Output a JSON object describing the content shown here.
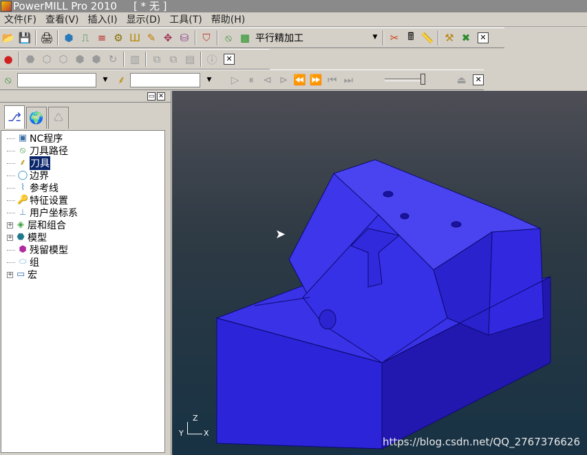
{
  "window": {
    "title": "PowerMILL Pro 2010",
    "document": "[ * 无 ]"
  },
  "menu": [
    "文件(F)",
    "查看(V)",
    "插入(I)",
    "显示(D)",
    "工具(T)",
    "帮助(H)"
  ],
  "toolbar": {
    "strategy_value": "平行精加工",
    "tool_combo_value": "",
    "tool_combo2_value": ""
  },
  "explorer": {
    "items": [
      {
        "label": "NC程序",
        "expandable": false,
        "selected": false
      },
      {
        "label": "刀具路径",
        "expandable": false,
        "selected": false
      },
      {
        "label": "刀具",
        "expandable": false,
        "selected": true
      },
      {
        "label": "边界",
        "expandable": false,
        "selected": false
      },
      {
        "label": "参考线",
        "expandable": false,
        "selected": false
      },
      {
        "label": "特征设置",
        "expandable": false,
        "selected": false
      },
      {
        "label": "用户坐标系",
        "expandable": false,
        "selected": false
      },
      {
        "label": "层和组合",
        "expandable": true,
        "selected": false
      },
      {
        "label": "模型",
        "expandable": true,
        "selected": false
      },
      {
        "label": "残留模型",
        "expandable": false,
        "selected": false
      },
      {
        "label": "组",
        "expandable": false,
        "selected": false
      },
      {
        "label": "宏",
        "expandable": true,
        "selected": false
      }
    ]
  },
  "viewport": {
    "watermark": "https://blog.csdn.net/QQ_2767376626",
    "axis_labels": {
      "z": "Z",
      "y": "Y",
      "x": "X"
    },
    "model_color": "#3a32e6"
  }
}
